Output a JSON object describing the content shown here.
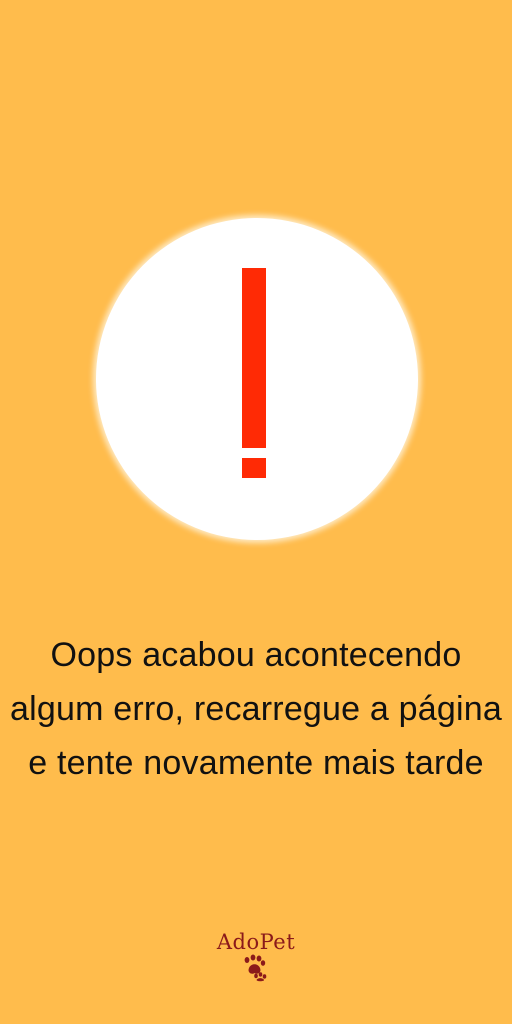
{
  "error": {
    "icon": "exclamation-icon",
    "message": "Oops acabou acontecendo algum erro, recarregue a página e tente novamente mais tarde"
  },
  "brand": {
    "name": "AdoPet",
    "icon": "paw-icon"
  },
  "colors": {
    "background": "#FFBC4C",
    "circle": "#FFFFFF",
    "exclamation": "#FF2A05",
    "text": "#111111",
    "brand": "#8B1A1A"
  }
}
